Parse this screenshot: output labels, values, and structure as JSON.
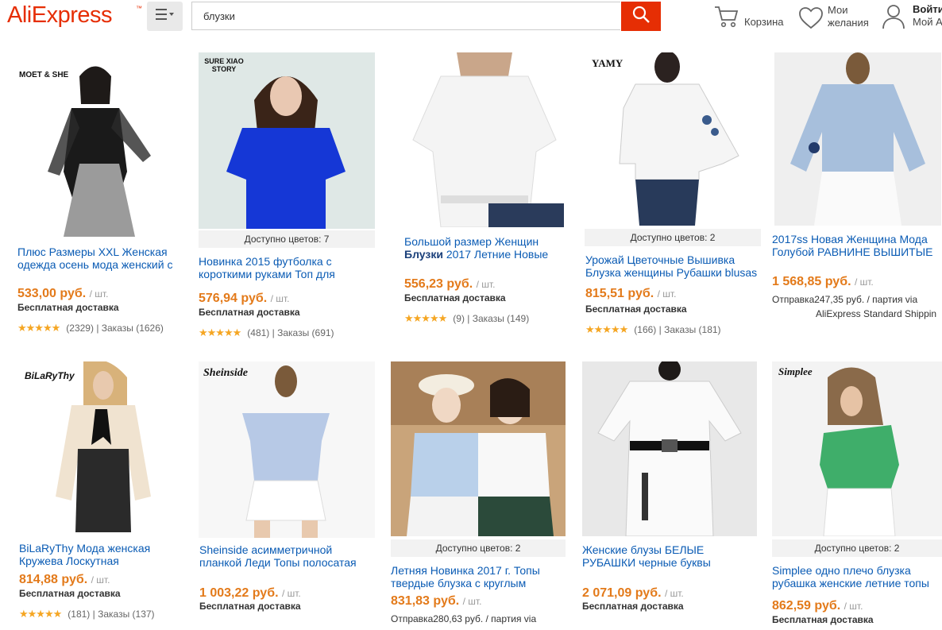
{
  "header": {
    "logo": "AliExpress",
    "search_value": "блузки",
    "cart_label": "Корзина",
    "wishlist_line1": "Мои",
    "wishlist_line2": "желания",
    "account_line1": "Войти",
    "account_line2": "Мой А"
  },
  "colors": {
    "accent": "#e62e04",
    "price": "#e37a1a",
    "link": "#0a5bb4",
    "star": "#f5a623"
  },
  "products": [
    {
      "brand": "MOET & SHE",
      "colors_avail": "",
      "title1": "Плюс Размеры XXL Женская",
      "title2": "одежда осень мода женский с",
      "price": "533,00 руб.",
      "unit": "/ шт.",
      "shipping": "Бесплатная доставка",
      "rating": "★★★★★",
      "reviews": "(2329)",
      "orders": "| Заказы (1626)"
    },
    {
      "brand": "SURE XIAO STORY",
      "colors_avail": "Доступно цветов: 7",
      "title1": "Новинка 2015 футболка с",
      "title2": "короткими руками Топ для",
      "price": "576,94 руб.",
      "unit": "/ шт.",
      "shipping": "Бесплатная доставка",
      "rating": "★★★★★",
      "reviews": "(481)",
      "orders": "| Заказы (691)"
    },
    {
      "brand": "",
      "colors_avail": "",
      "title1": "Большой размер Женщин",
      "title2_bold": "Блузки",
      "title2": " 2017 Летние Новые",
      "price": "556,23 руб.",
      "unit": "/ шт.",
      "shipping": "Бесплатная доставка",
      "rating": "★★★★★",
      "reviews": "(9)",
      "orders": "| Заказы (149)"
    },
    {
      "brand": "YAMY",
      "colors_avail": "Доступно цветов: 2",
      "title1": "Урожай Цветочные Вышивка",
      "title2": "Блузка женщины Рубашки blusas",
      "price": "815,51 руб.",
      "unit": "/ шт.",
      "shipping": "Бесплатная доставка",
      "rating": "★★★★★",
      "reviews": "(166)",
      "orders": "| Заказы (181)"
    },
    {
      "brand": "",
      "colors_avail": "",
      "title1": "2017ss Новая Женщина Мода",
      "title2": "Голубой РАВНИНЕ ВЫШИТЫЕ",
      "price": "1 568,85 руб.",
      "unit": "/ шт.",
      "shipnote1": "Отправка247,35 руб. / партия via",
      "shipnote2": "AliExpress Standard Shippin"
    },
    {
      "brand": "BiLaRyThy",
      "colors_avail": "",
      "title1": "BiLaRyThy Мода женская",
      "title2": "Кружева Лоскутная",
      "price": "814,88 руб.",
      "unit": "/ шт.",
      "shipping": "Бесплатная доставка",
      "rating": "★★★★★",
      "reviews": "(181)",
      "orders": "| Заказы (137)"
    },
    {
      "brand": "Sheinside",
      "colors_avail": "",
      "title1": "Sheinside асимметричной",
      "title2": "планкой Леди Топы полосатая",
      "price": "1 003,22 руб.",
      "unit": "/ шт.",
      "shipping": "Бесплатная доставка"
    },
    {
      "brand": "",
      "colors_avail": "Доступно цветов: 2",
      "title1": "Летняя Новинка 2017 г. Топы",
      "title2": "твердые блузка с круглым",
      "price": "831,83 руб.",
      "unit": "/ шт.",
      "shipnote1": "Отправка280,63 руб. / партия via"
    },
    {
      "brand": "",
      "colors_avail": "",
      "title1": "Женские блузы БЕЛЫЕ",
      "title2": "РУБАШКИ черные буквы",
      "price": "2 071,09 руб.",
      "unit": "/ шт.",
      "shipping": "Бесплатная доставка"
    },
    {
      "brand": "Simplee",
      "colors_avail": "Доступно цветов: 2",
      "title1": "Simplee одно плечо блузка",
      "title2": "рубашка женские летние топы",
      "price": "862,59 руб.",
      "unit": "/ шт.",
      "shipping": "Бесплатная доставка"
    }
  ]
}
